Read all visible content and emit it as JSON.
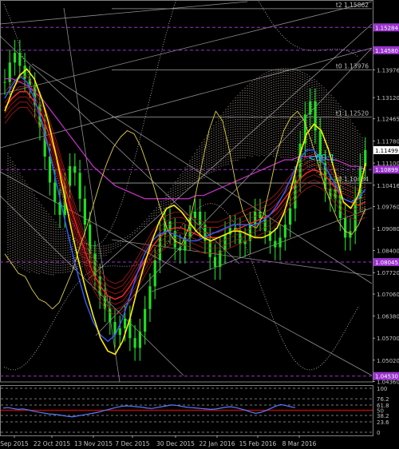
{
  "chart_data": {
    "type": "line",
    "main": {
      "ylim": [
        1.0435,
        1.1608
      ],
      "price_ticks": [
        1.15284,
        1.1458,
        1.13976,
        1.1312,
        1.12465,
        1.1178,
        1.111,
        1.10416,
        1.0976,
        1.0908,
        1.084,
        1.0772,
        1.0706,
        1.0638,
        1.057,
        1.0502,
        1.0436
      ],
      "price_tick_labels": [
        "1.15284",
        "1.14580",
        "1.13976",
        "1.13120",
        "1.12465",
        "1.11780",
        "1.11100",
        "1.10416",
        "1.09760",
        "1.09080",
        "1.08400",
        "1.07720",
        "1.07060",
        "1.06380",
        "1.05700",
        "1.05020",
        "1.04360"
      ],
      "current_price": 1.11499,
      "current_price_label": "1.11499",
      "highlight_levels": [
        {
          "value": 1.15284,
          "label": "1.15284",
          "color": "#9933cc"
        },
        {
          "value": 1.1458,
          "label": "1.14580",
          "color": "#9933cc"
        },
        {
          "value": 1.10899,
          "label": "1.10899",
          "color": "#9933cc"
        },
        {
          "value": 1.08045,
          "label": "1.08045",
          "color": "#9933cc"
        },
        {
          "value": 1.0453,
          "label": "1.04530",
          "color": "#9933cc"
        }
      ],
      "level_labels": [
        {
          "value": 1.15862,
          "label": "t2 1.15862"
        },
        {
          "value": 1.13976,
          "label": "t0 1.13976"
        },
        {
          "value": 1.1252,
          "label": "t1 1.12520"
        },
        {
          "value": 1.10484,
          "label": "t0 1.10484"
        }
      ],
      "annotation": "<60:1",
      "annotation_color": "#00e5e5",
      "price_series": [
        1.136,
        1.142,
        1.145,
        1.141,
        1.137,
        1.135,
        1.129,
        1.122,
        1.113,
        1.105,
        1.099,
        1.095,
        1.104,
        1.11,
        1.108,
        1.1,
        1.092,
        1.083,
        1.076,
        1.07,
        1.066,
        1.062,
        1.058,
        1.06,
        1.063,
        1.057,
        1.054,
        1.059,
        1.066,
        1.073,
        1.081,
        1.089,
        1.093,
        1.09,
        1.085,
        1.084,
        1.088,
        1.094,
        1.096,
        1.092,
        1.087,
        1.082,
        1.079,
        1.084,
        1.089,
        1.091,
        1.09,
        1.086,
        1.087,
        1.092,
        1.096,
        1.094,
        1.09,
        1.087,
        1.085,
        1.088,
        1.092,
        1.097,
        1.106,
        1.117,
        1.126,
        1.13,
        1.121,
        1.111,
        1.103,
        1.1,
        1.103,
        1.094,
        1.088,
        1.09,
        1.1,
        1.11,
        1.115
      ],
      "yellow_series": [
        1.127,
        1.133,
        1.138,
        1.14,
        1.137,
        1.131,
        1.123,
        1.113,
        1.102,
        1.091,
        1.081,
        1.072,
        1.064,
        1.057,
        1.053,
        1.052,
        1.056,
        1.063,
        1.072,
        1.08,
        1.087,
        1.093,
        1.097,
        1.098,
        1.096,
        1.093,
        1.09,
        1.088,
        1.087,
        1.088,
        1.089,
        1.09,
        1.09,
        1.089,
        1.088,
        1.088,
        1.089,
        1.091,
        1.096,
        1.104,
        1.113,
        1.12,
        1.123,
        1.121,
        1.115,
        1.107,
        1.099,
        1.097,
        1.101,
        1.111
      ],
      "blue_series": [
        1.131,
        1.135,
        1.138,
        1.136,
        1.131,
        1.124,
        1.115,
        1.105,
        1.095,
        1.085,
        1.076,
        1.068,
        1.062,
        1.058,
        1.056,
        1.058,
        1.063,
        1.07,
        1.077,
        1.083,
        1.087,
        1.089,
        1.09,
        1.089,
        1.088,
        1.087,
        1.087,
        1.088,
        1.089,
        1.09,
        1.091,
        1.092,
        1.092,
        1.092,
        1.092,
        1.093,
        1.095,
        1.098,
        1.102,
        1.107,
        1.112,
        1.115,
        1.115,
        1.112,
        1.108,
        1.104,
        1.1,
        1.099,
        1.1,
        1.103
      ],
      "red_series": [
        1.128,
        1.131,
        1.133,
        1.133,
        1.13,
        1.126,
        1.12,
        1.113,
        1.105,
        1.097,
        1.09,
        1.083,
        1.077,
        1.073,
        1.07,
        1.069,
        1.07,
        1.073,
        1.077,
        1.081,
        1.085,
        1.088,
        1.09,
        1.091,
        1.091,
        1.09,
        1.089,
        1.088,
        1.088,
        1.088,
        1.089,
        1.09,
        1.091,
        1.092,
        1.093,
        1.094,
        1.095,
        1.097,
        1.1,
        1.103,
        1.106,
        1.108,
        1.109,
        1.108,
        1.106,
        1.103,
        1.1,
        1.099,
        1.098,
        1.099
      ],
      "magenta_series": [
        1.137,
        1.137,
        1.136,
        1.135,
        1.133,
        1.131,
        1.128,
        1.125,
        1.122,
        1.119,
        1.116,
        1.113,
        1.11,
        1.108,
        1.106,
        1.104,
        1.103,
        1.102,
        1.101,
        1.1,
        1.1,
        1.1,
        1.1,
        1.1,
        1.1,
        1.1,
        1.101,
        1.101,
        1.102,
        1.103,
        1.104,
        1.105,
        1.106,
        1.107,
        1.108,
        1.109,
        1.11,
        1.111,
        1.112,
        1.112,
        1.113,
        1.113,
        1.113,
        1.113,
        1.112,
        1.112,
        1.111,
        1.11,
        1.11,
        1.109
      ],
      "yellow_osc_series": [
        1.083,
        1.08,
        1.077,
        1.076,
        1.072,
        1.069,
        1.068,
        1.066,
        1.068,
        1.073,
        1.078,
        1.085,
        1.091,
        1.098,
        1.105,
        1.111,
        1.116,
        1.119,
        1.121,
        1.12,
        1.116,
        1.11,
        1.103,
        1.096,
        1.09,
        1.087,
        1.086,
        1.091,
        1.101,
        1.111,
        1.121,
        1.127,
        1.124,
        1.115,
        1.104,
        1.096,
        1.092,
        1.091,
        1.095,
        1.104,
        1.114,
        1.121,
        1.125,
        1.127,
        1.124,
        1.118,
        1.111,
        1.104,
        1.098,
        1.093,
        1.09,
        1.089,
        1.092,
        1.097
      ]
    },
    "oscillator": {
      "ylim": [
        0,
        100
      ],
      "levels": [
        100,
        76.2,
        61.8,
        50,
        38.2,
        23.6,
        0
      ],
      "level_labels": [
        "100",
        "76.2",
        "61.8",
        "50",
        "38.2",
        "23.6",
        "0"
      ],
      "red_level": 50,
      "series": [
        55,
        56,
        54,
        52,
        53,
        51,
        48,
        46,
        44,
        42,
        41,
        40,
        38,
        36,
        35,
        37,
        39,
        41,
        43,
        45,
        48,
        51,
        54,
        57,
        59,
        60,
        59,
        58,
        57,
        55,
        54,
        56,
        58,
        60,
        62,
        61,
        59,
        57,
        56,
        55,
        54,
        53,
        52,
        53,
        55,
        57,
        58,
        56,
        53,
        50,
        46,
        43,
        45,
        49,
        54,
        59,
        63,
        61,
        58,
        56
      ]
    },
    "x_axis": {
      "labels": [
        "Sep 2015",
        "22 Oct 2015",
        "13 Nov 2015",
        "7 Dec 2015",
        "30 Dec 2015",
        "22 Jan 2016",
        "15 Feb 2016",
        "8 Mar 2016"
      ]
    }
  }
}
